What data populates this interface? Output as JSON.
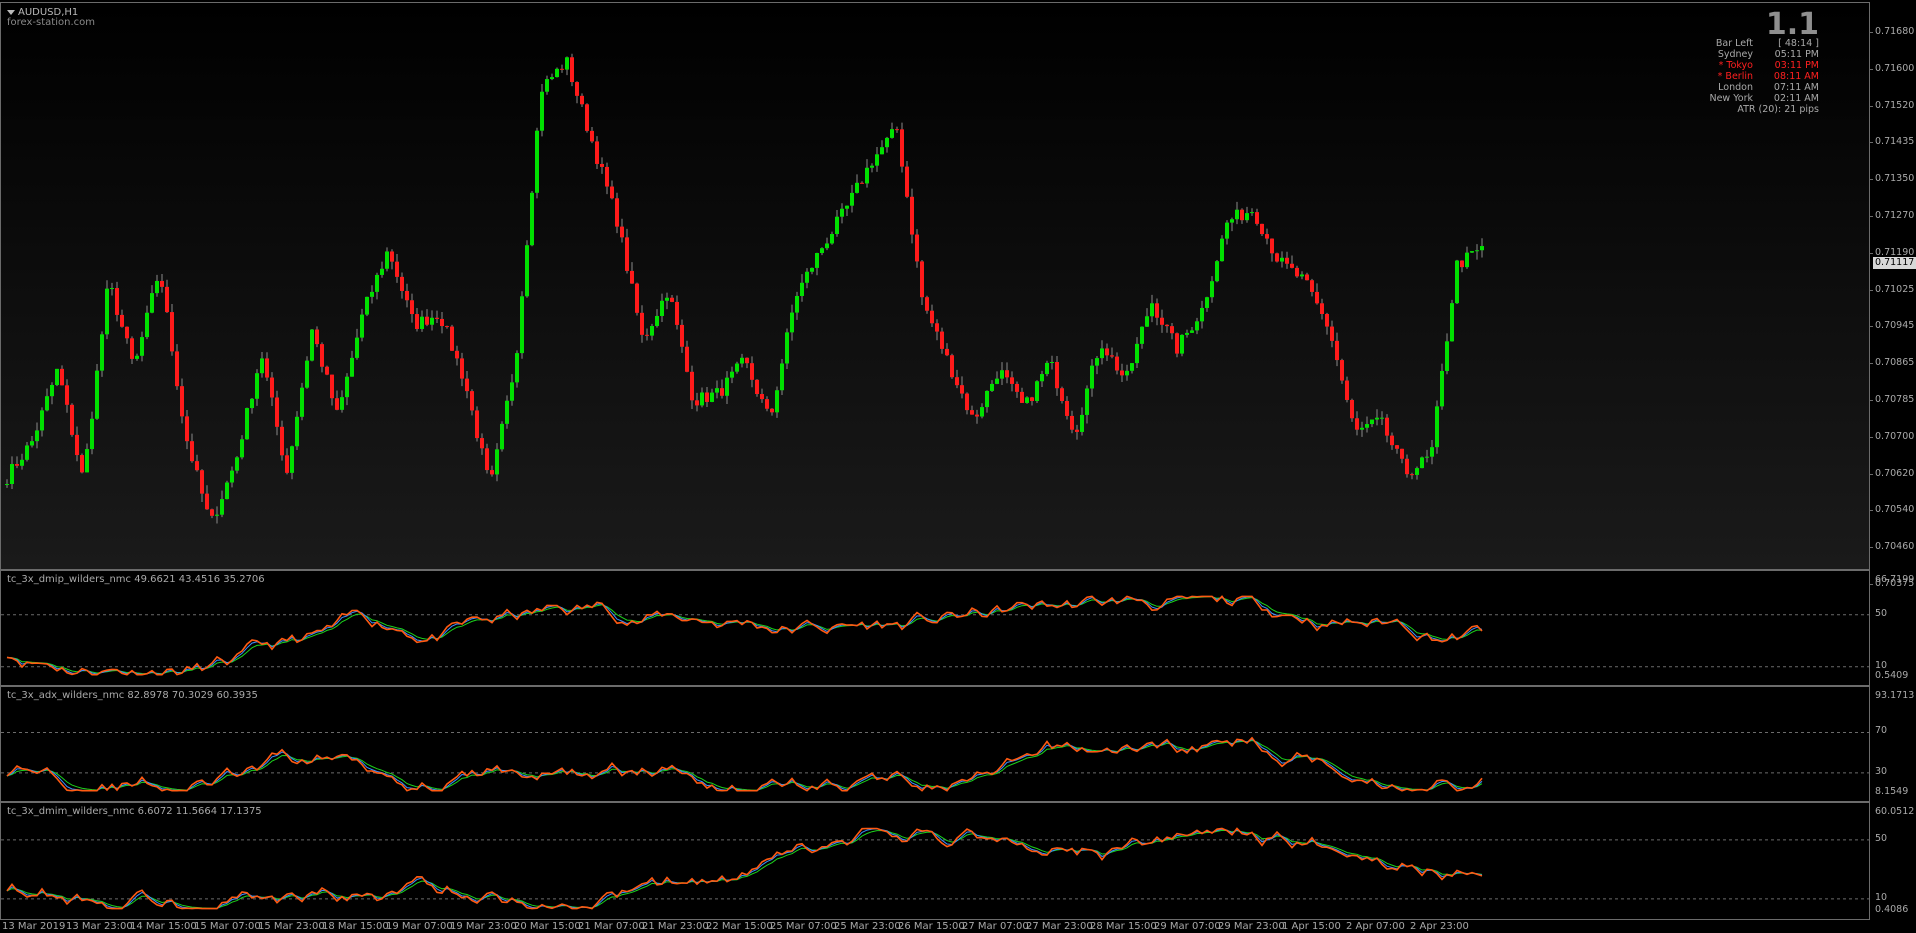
{
  "chart_header": {
    "symbol": "AUDUSD,H1",
    "source": "forex-station.com"
  },
  "info_box": {
    "big_value": "1.1",
    "rows": [
      {
        "label": "Bar Left",
        "value": "[ 48:14 ]",
        "color": "#a9a9a9"
      },
      {
        "label": "Sydney",
        "value": "05:11 PM",
        "color": "#a9a9a9"
      },
      {
        "label": "* Tokyo",
        "value": "03:11 PM",
        "color": "#ff2020"
      },
      {
        "label": "* Berlin",
        "value": "08:11 AM",
        "color": "#ff2020"
      },
      {
        "label": "London",
        "value": "07:11 AM",
        "color": "#a9a9a9"
      },
      {
        "label": "New York",
        "value": "02:11 AM",
        "color": "#a9a9a9"
      }
    ],
    "atr_text": "ATR (20): 21 pips"
  },
  "current_price": "0.71117",
  "colors": {
    "bull": "#00e000",
    "bear": "#ff1a1a",
    "line_orange": "#ff5a12",
    "line_blue": "#3a8fff",
    "line_green": "#1bd11b"
  },
  "main_axis": {
    "labels": [
      "0.71680",
      "0.71600",
      "0.71520",
      "0.71435",
      "0.71350",
      "0.71270",
      "0.71190",
      "0.71025",
      "0.70945",
      "0.70865",
      "0.70785",
      "0.70700",
      "0.70620",
      "0.70540",
      "0.70460",
      "0.70375"
    ],
    "ylim": [
      0.70375,
      0.7172
    ]
  },
  "indicators": [
    {
      "title": "tc_3x_dmip_wilders_nmc 49.6621 43.4516 35.2706",
      "max": "66.7199",
      "level_hi": "50",
      "level_lo": "10",
      "min": "0.5409",
      "range": [
        0.5409,
        66.7199
      ],
      "levels": [
        50,
        10
      ]
    },
    {
      "title": "tc_3x_adx_wilders_nmc 82.8978 70.3029 60.3935",
      "max": "93.1713",
      "level_hi": "70",
      "level_lo": "30",
      "min": "8.1549",
      "range": [
        8.1549,
        93.1713
      ],
      "levels": [
        70,
        30
      ]
    },
    {
      "title": "tc_3x_dmim_wilders_nmc 6.6072 11.5664 17.1375",
      "max": "60.0512",
      "level_hi": "50",
      "level_lo": "10",
      "min": "0.4086",
      "range": [
        0.4086,
        60.0512
      ],
      "levels": [
        50,
        10
      ]
    }
  ],
  "x_axis": {
    "labels": [
      "13 Mar 2019",
      "13 Mar 23:00",
      "14 Mar 15:00",
      "15 Mar 07:00",
      "15 Mar 23:00",
      "18 Mar 15:00",
      "19 Mar 07:00",
      "19 Mar 23:00",
      "20 Mar 15:00",
      "21 Mar 07:00",
      "21 Mar 23:00",
      "22 Mar 15:00",
      "25 Mar 07:00",
      "25 Mar 23:00",
      "26 Mar 15:00",
      "27 Mar 07:00",
      "27 Mar 23:00",
      "28 Mar 15:00",
      "29 Mar 07:00",
      "29 Mar 23:00",
      "1 Apr 15:00",
      "2 Apr 07:00",
      "2 Apr 23:00"
    ]
  },
  "chart_data": {
    "type": "candlestick",
    "title": "AUDUSD,H1",
    "price_anchors": [
      0.7061,
      0.707,
      0.7088,
      0.706,
      0.711,
      0.7088,
      0.7113,
      0.7072,
      0.7049,
      0.7065,
      0.7092,
      0.7062,
      0.7098,
      0.7076,
      0.7102,
      0.7118,
      0.7099,
      0.7102,
      0.7085,
      0.7058,
      0.709,
      0.7158,
      0.7165,
      0.7145,
      0.7125,
      0.7095,
      0.7108,
      0.708,
      0.7082,
      0.709,
      0.7075,
      0.7106,
      0.7118,
      0.7128,
      0.714,
      0.7148,
      0.7105,
      0.709,
      0.7075,
      0.7088,
      0.7078,
      0.709,
      0.7072,
      0.7095,
      0.7085,
      0.7105,
      0.7093,
      0.7103,
      0.7125,
      0.7128,
      0.7115,
      0.711,
      0.7098,
      0.7072,
      0.7075,
      0.7062,
      0.7066,
      0.7114,
      0.7118
    ]
  }
}
